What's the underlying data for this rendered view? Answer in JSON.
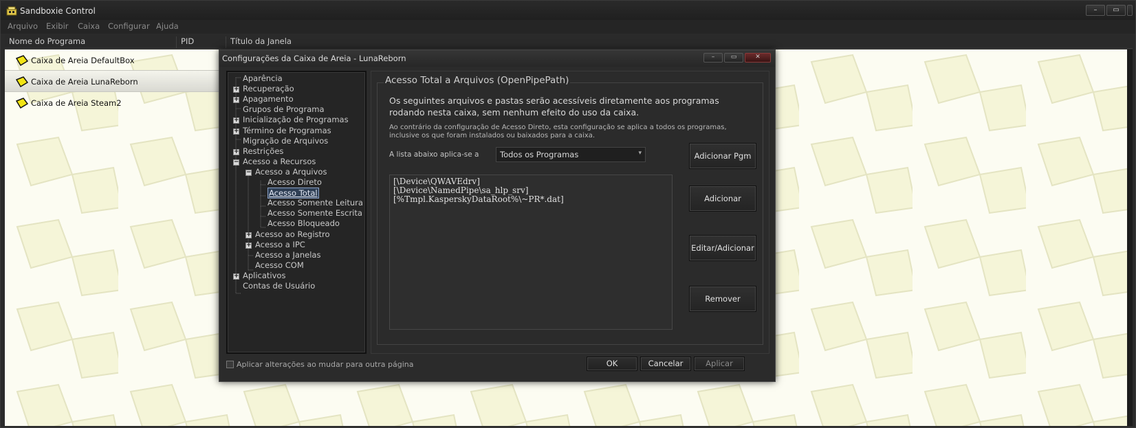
{
  "app": {
    "title": "Sandboxie Control",
    "window_buttons": [
      "–",
      "▭",
      "✕"
    ]
  },
  "menu": [
    "Arquivo",
    "Exibir",
    "Caixa",
    "Configurar",
    "Ajuda"
  ],
  "columns": [
    "Nome do Programa",
    "PID",
    "Título da Janela"
  ],
  "sandboxes": [
    {
      "label": "Caixa de Areia DefaultBox",
      "selected": false
    },
    {
      "label": "Caixa de Areia LunaReborn",
      "selected": true
    },
    {
      "label": "Caixa de Areia Steam2",
      "selected": false
    }
  ],
  "dialog": {
    "title": "Configurações da Caixa de Areia - LunaReborn",
    "window_buttons": [
      "–",
      "▭",
      "✕"
    ],
    "tree": [
      {
        "label": "Aparência",
        "expander": ""
      },
      {
        "label": "Recuperação",
        "expander": "+"
      },
      {
        "label": "Apagamento",
        "expander": "+"
      },
      {
        "label": "Grupos de Programa",
        "expander": ""
      },
      {
        "label": "Inicialização de Programas",
        "expander": "+"
      },
      {
        "label": "Término de Programas",
        "expander": "+"
      },
      {
        "label": "Migração de Arquivos",
        "expander": ""
      },
      {
        "label": "Restrições",
        "expander": "+"
      },
      {
        "label": "Acesso a Recursos",
        "expander": "−"
      },
      {
        "label": "Acesso a Arquivos",
        "expander": "−"
      },
      {
        "label": "Acesso Direto",
        "expander": ""
      },
      {
        "label": "Acesso Total",
        "expander": "",
        "selected": true
      },
      {
        "label": "Acesso Somente Leitura",
        "expander": ""
      },
      {
        "label": "Acesso Somente Escrita",
        "expander": ""
      },
      {
        "label": "Acesso Bloqueado",
        "expander": ""
      },
      {
        "label": "Acesso ao Registro",
        "expander": "+"
      },
      {
        "label": "Acesso a IPC",
        "expander": "+"
      },
      {
        "label": "Acesso a Janelas",
        "expander": ""
      },
      {
        "label": "Acesso COM",
        "expander": ""
      },
      {
        "label": "Aplicativos",
        "expander": "+"
      },
      {
        "label": "Contas de Usuário",
        "expander": ""
      }
    ],
    "group_title": "Acesso Total a Arquivos (OpenPipePath)",
    "description": "Os seguintes arquivos e pastas serão acessíveis diretamente aos programas rodando nesta caixa, sem nenhum efeito do uso da caixa.",
    "description_sub": "Ao contrário da configuração de Acesso Direto, esta configuração se aplica a todos os programas, inclusive os que foram instalados ou baixados para a caixa.",
    "applies_label": "A lista abaixo aplica-se a",
    "program_select": "Todos os Programas",
    "paths": [
      "[\\Device\\QWAVEdrv]",
      "[\\Device\\NamedPipe\\sa_hlp_srv]",
      "[%Tmpl.KasperskyDataRoot%\\~PR*.dat]"
    ],
    "buttons": {
      "add_program": "Adicionar Pgm",
      "add": "Adicionar",
      "edit_add": "Editar/Adicionar",
      "remove": "Remover",
      "ok": "OK",
      "cancel": "Cancelar",
      "apply": "Aplicar"
    },
    "apply_on_change_label": "Aplicar alterações ao mudar para outra página"
  }
}
